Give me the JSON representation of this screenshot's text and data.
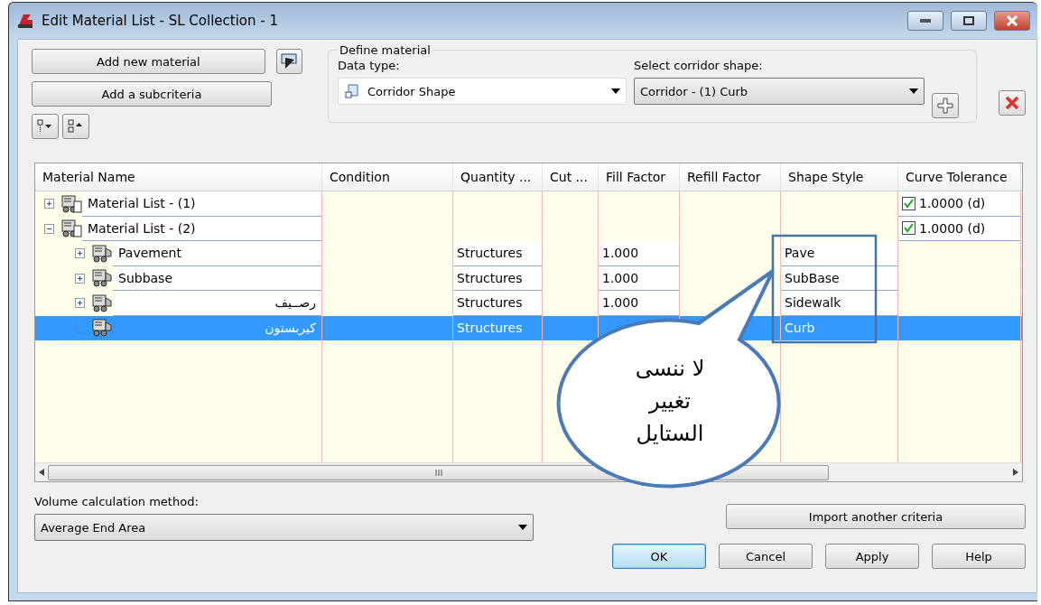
{
  "window": {
    "title": "Edit Material List - SL Collection - 1"
  },
  "buttons_left": [
    "Add new material",
    "Add a subcriteria"
  ],
  "define_material": {
    "legend": "Define material",
    "data_type_label": "Data type:",
    "data_type_value": "Corridor Shape",
    "corridor_shape_label": "Select corridor shape:",
    "corridor_shape_value": "Corridor - (1) Curb"
  },
  "table": {
    "columns": [
      "Material Name",
      "Condition",
      "Quantity ...",
      "Cut ...",
      "Fill Factor",
      "Refill Factor",
      "Shape Style",
      "Curve Tolerance"
    ],
    "rows": [
      {
        "name": "Material List - (1)",
        "expandable": true,
        "expanded": false,
        "selected": false,
        "curve_tolerance": {
          "checked": true,
          "value": "1.0000 (d)"
        }
      },
      {
        "name": "Material List - (2)",
        "expandable": true,
        "expanded": true,
        "selected": false,
        "curve_tolerance": {
          "checked": true,
          "value": "1.0000 (d)"
        },
        "children": [
          {
            "name": "Pavement",
            "expandable": true,
            "expanded": false,
            "selected": false,
            "quantity": "Structures",
            "fill_factor": "1.000",
            "shape_style": "Pave"
          },
          {
            "name": "Subbase",
            "expandable": true,
            "expanded": false,
            "selected": false,
            "quantity": "Structures",
            "fill_factor": "1.000",
            "shape_style": "SubBase"
          },
          {
            "name": "رصــيف",
            "expandable": true,
            "expanded": false,
            "selected": false,
            "quantity": "Structures",
            "fill_factor": "1.000",
            "shape_style": "Sidewalk"
          },
          {
            "name": "كيربستون",
            "expandable": false,
            "expanded": false,
            "selected": true,
            "quantity": "Structures",
            "shape_style": "Curb"
          }
        ]
      }
    ]
  },
  "callout": {
    "lines": [
      "لا ننسى",
      "تغيير",
      "الستايل"
    ]
  },
  "volume": {
    "label": "Volume calculation method:",
    "value": "Average End Area"
  },
  "import_button": "Import another criteria",
  "footer_buttons": [
    {
      "label": "OK",
      "default": true
    },
    {
      "label": "Cancel",
      "default": false
    },
    {
      "label": "Apply",
      "default": false
    },
    {
      "label": "Help",
      "default": false
    }
  ]
}
